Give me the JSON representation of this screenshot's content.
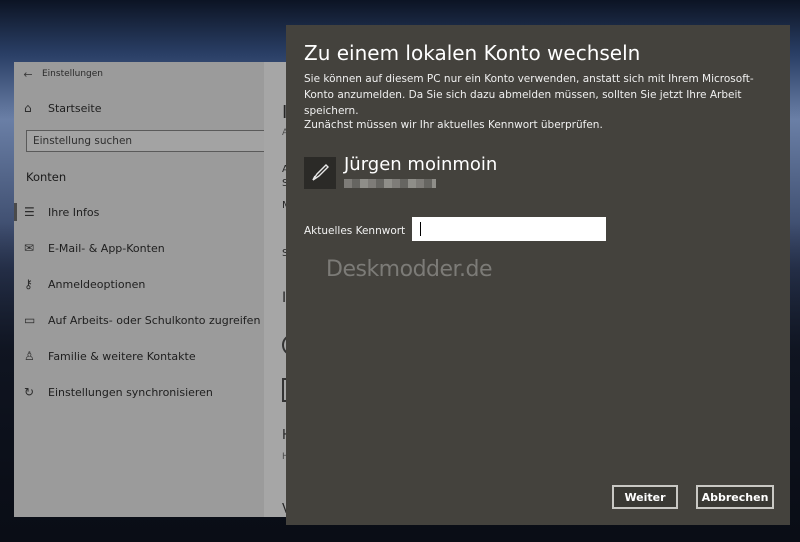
{
  "settings_window": {
    "title": "Einstellungen",
    "home": "Startseite",
    "search_placeholder": "Einstellung suchen",
    "section": "Konten",
    "nav": [
      {
        "label": "Ihre Infos",
        "icon": "person-card-icon"
      },
      {
        "label": "E-Mail- & App-Konten",
        "icon": "mail-icon"
      },
      {
        "label": "Anmeldeoptionen",
        "icon": "key-icon"
      },
      {
        "label": "Auf Arbeits- oder Schulkonto zugreifen",
        "icon": "briefcase-icon"
      },
      {
        "label": "Familie & weitere Kontakte",
        "icon": "family-icon"
      },
      {
        "label": "Einstellungen synchronisieren",
        "icon": "sync-icon"
      }
    ],
    "right_panel_fragments": {
      "heading": "Ihr",
      "sub1": "Adr",
      "t1": "Abr",
      "t2": "Sich",
      "t3": "Me",
      "t4": "Stat",
      "heading2": "Ihr",
      "t5": "Ha",
      "t6": "Hilf",
      "t7": "Ve"
    }
  },
  "dialog": {
    "title": "Zu einem lokalen Konto wechseln",
    "description": "Sie können auf diesem PC nur ein Konto verwenden, anstatt sich mit Ihrem Microsoft-Konto anzumelden. Da Sie sich dazu abmelden müssen, sollten Sie jetzt Ihre Arbeit speichern.",
    "verify_text": "Zunächst müssen wir Ihr aktuelles Kennwort überprüfen.",
    "user_name": "Jürgen moinmoin",
    "password_label": "Aktuelles Kennwort",
    "password_value": "",
    "watermark": "Deskmodder.de",
    "next_button": "Weiter",
    "cancel_button": "Abbrechen"
  }
}
